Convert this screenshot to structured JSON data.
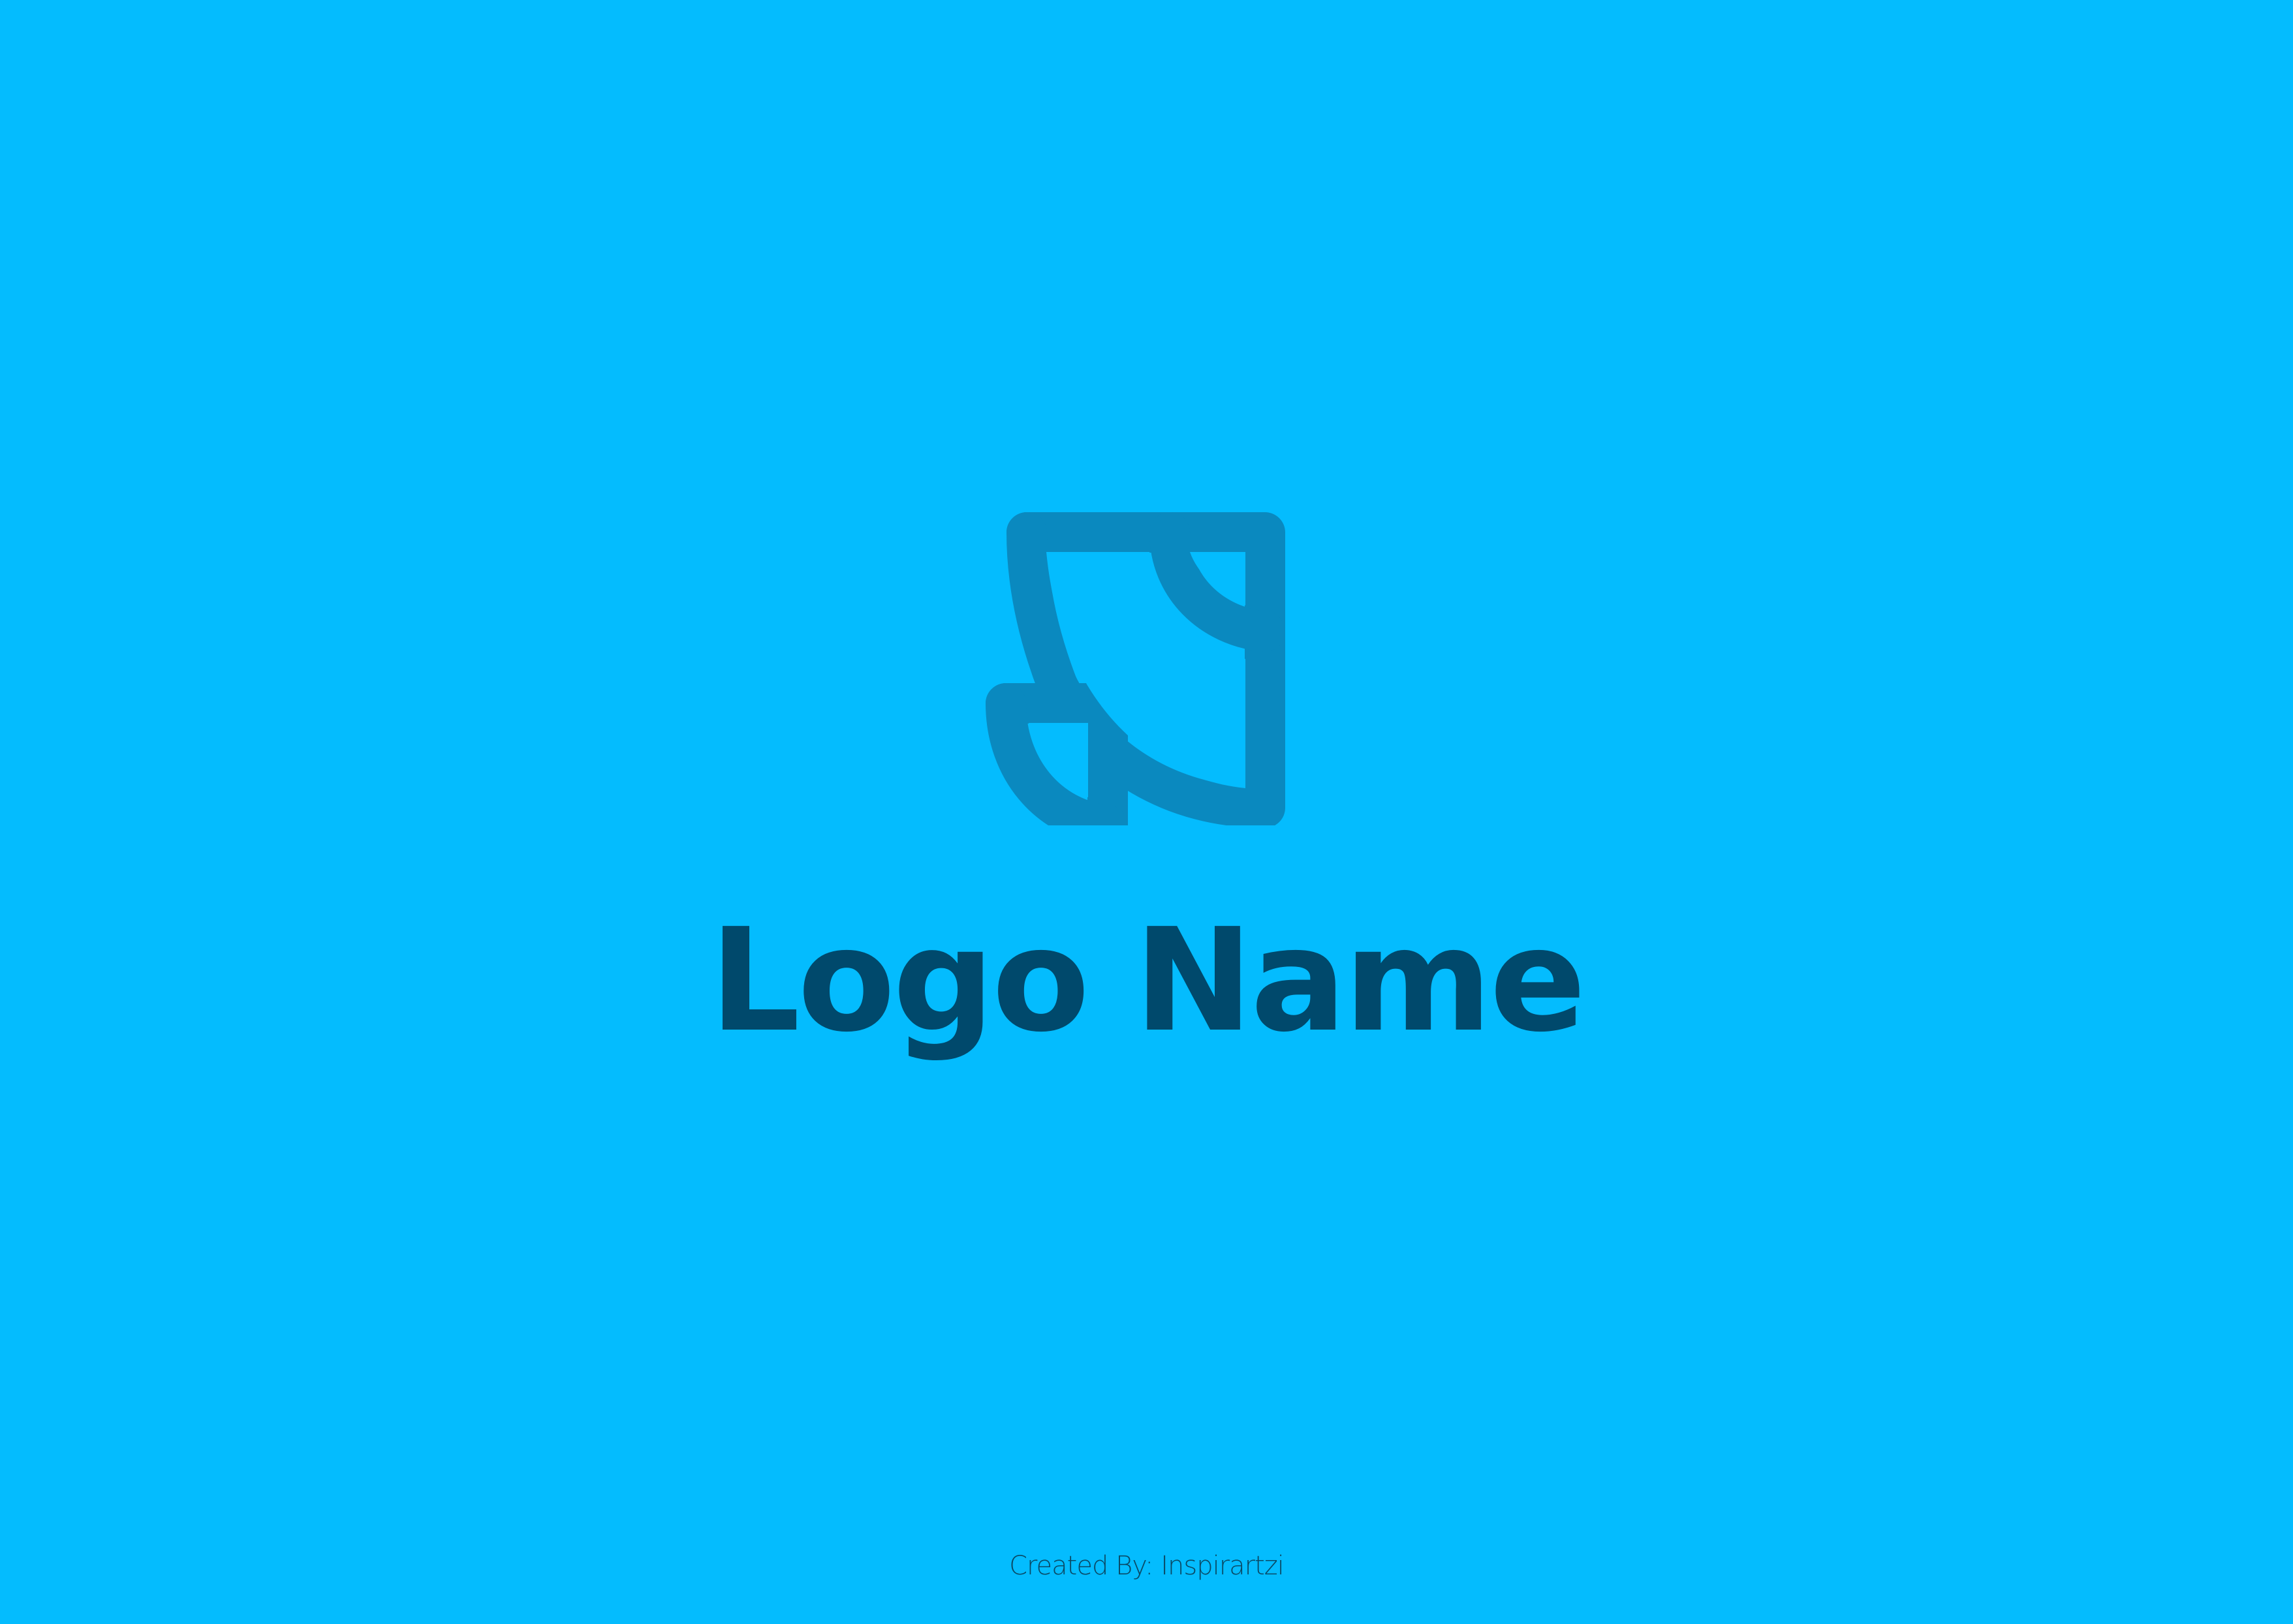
{
  "colors": {
    "background": "#04BCFE",
    "mark": "#0A89BF",
    "name_text": "#00496C",
    "credit_text": "#0A4A66"
  },
  "logo": {
    "icon": "abstract-quarter-circle-leaf-mark-icon",
    "name": "Logo Name"
  },
  "footer": {
    "credit": "Created By: Inspirartzi"
  }
}
